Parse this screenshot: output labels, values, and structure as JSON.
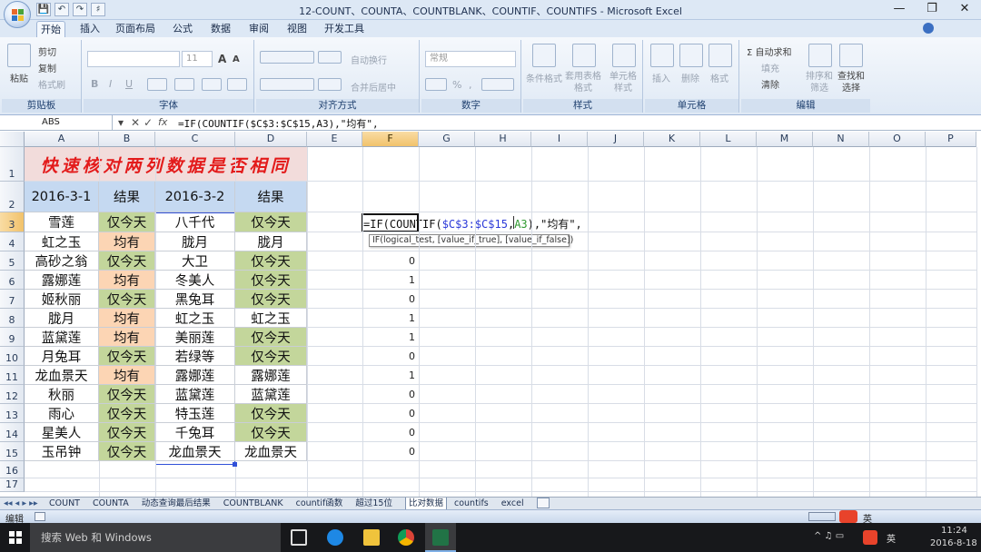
{
  "window": {
    "title": "12-COUNT、COUNTA、COUNTBLANK、COUNTIF、COUNTIFS - Microsoft Excel",
    "minimize": "—",
    "restore": "❐",
    "close": "✕"
  },
  "quick_access": [
    "💾",
    "↶",
    "↷",
    "♯"
  ],
  "tabs": [
    "开始",
    "插入",
    "页面布局",
    "公式",
    "数据",
    "审阅",
    "视图",
    "开发工具"
  ],
  "ribbon": {
    "clipboard": {
      "paste": "粘贴",
      "cut": "剪切",
      "copy": "复制",
      "format_painter": "格式刷",
      "label": "剪贴板"
    },
    "font": {
      "font_size": "11",
      "bold": "B",
      "italic": "I",
      "underline": "U",
      "grow": "A",
      "shrink": "A",
      "label": "字体"
    },
    "alignment": {
      "wrap": "自动换行",
      "merge": "合并后居中",
      "label": "对齐方式"
    },
    "number": {
      "format": "常规",
      "percent": "%",
      "comma": ",",
      "label": "数字"
    },
    "styles": {
      "conditional": "条件格式",
      "table_format": "套用表格格式",
      "cell_style": "单元格样式",
      "label": "样式"
    },
    "cells": {
      "insert": "插入",
      "delete": "删除",
      "format": "格式",
      "label": "单元格"
    },
    "editing": {
      "autosum": "Σ 自动求和",
      "fill": "填充",
      "clear": "清除",
      "sort": "排序和筛选",
      "find": "查找和选择",
      "label": "编辑"
    }
  },
  "formula_bar": {
    "name_box": "ABS",
    "cancel": "✕",
    "enter": "✓",
    "fx": "fx",
    "formula": "=IF(COUNTIF($C$3:$C$15,A3),\"均有\","
  },
  "columns": [
    "A",
    "B",
    "C",
    "D",
    "E",
    "F",
    "G",
    "H",
    "I",
    "J",
    "K",
    "L",
    "M",
    "N",
    "O",
    "P"
  ],
  "rows": [
    "1",
    "2",
    "3",
    "4",
    "5",
    "6",
    "7",
    "8",
    "9",
    "10",
    "11",
    "12",
    "13",
    "14",
    "15",
    "16",
    "17"
  ],
  "sheet": {
    "title": "快速核对两列数据是否相同",
    "headers": [
      "2016-3-1",
      "结果",
      "2016-3-2",
      "结果"
    ],
    "rows": [
      {
        "a": "雪莲",
        "b": "仅今天",
        "c": "八千代",
        "d": "仅今天",
        "f": ""
      },
      {
        "a": "虹之玉",
        "b": "均有",
        "c": "胧月",
        "d": "胧月",
        "f": ""
      },
      {
        "a": "高砂之翁",
        "b": "仅今天",
        "c": "大卫",
        "d": "仅今天",
        "f": "0"
      },
      {
        "a": "露娜莲",
        "b": "均有",
        "c": "冬美人",
        "d": "仅今天",
        "f": "1"
      },
      {
        "a": "姬秋丽",
        "b": "仅今天",
        "c": "黑兔耳",
        "d": "仅今天",
        "f": "0"
      },
      {
        "a": "胧月",
        "b": "均有",
        "c": "虹之玉",
        "d": "虹之玉",
        "f": "1"
      },
      {
        "a": "蓝黛莲",
        "b": "均有",
        "c": "美丽莲",
        "d": "仅今天",
        "f": "1"
      },
      {
        "a": "月兔耳",
        "b": "仅今天",
        "c": "若绿等",
        "d": "仅今天",
        "f": "0"
      },
      {
        "a": "龙血景天",
        "b": "均有",
        "c": "露娜莲",
        "d": "露娜莲",
        "f": "1"
      },
      {
        "a": "秋丽",
        "b": "仅今天",
        "c": "蓝黛莲",
        "d": "蓝黛莲",
        "f": "0"
      },
      {
        "a": "雨心",
        "b": "仅今天",
        "c": "特玉莲",
        "d": "仅今天",
        "f": "0"
      },
      {
        "a": "星美人",
        "b": "仅今天",
        "c": "千兔耳",
        "d": "仅今天",
        "f": "0"
      },
      {
        "a": "玉吊钟",
        "b": "仅今天",
        "c": "龙血景天",
        "d": "龙血景天",
        "f": "0"
      }
    ]
  },
  "edit_cell": {
    "prefix": "=IF(COUNTIF(",
    "range": "$C$3:$C$15",
    "sep": ",",
    "ref": "A3",
    "suffix": "),\"均有\","
  },
  "tooltip": {
    "text": "IF(logical_test, [value_if_true], [value_if_false])"
  },
  "sheet_tabs": [
    "COUNT",
    "COUNTA",
    "动态查询最后结果",
    "COUNTBLANK",
    "countif函数",
    "超过15位",
    "比对数据",
    "countifs",
    "excel"
  ],
  "active_sheet": "比对数据",
  "status": {
    "mode": "编辑",
    "ime": "英"
  },
  "taskbar": {
    "search": "搜索 Web 和 Windows",
    "time": "11:24",
    "date": "2016-8-18",
    "lang": "英"
  },
  "colors": {
    "green": "#c3d69b",
    "peach": "#fcd5b4",
    "blue": "#c5d9f1",
    "pink": "#f2dcdb",
    "title_red": "#e31b1b"
  }
}
